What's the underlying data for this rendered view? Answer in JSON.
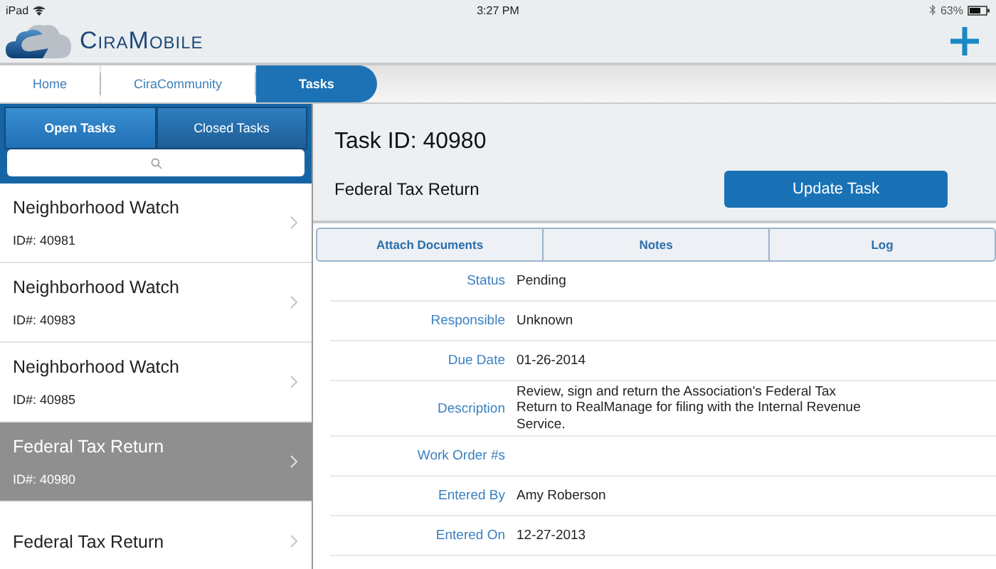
{
  "status_bar": {
    "device": "iPad",
    "time": "3:27 PM",
    "battery": "63%"
  },
  "header": {
    "logo_text": "CiraMobile"
  },
  "nav_tabs": [
    {
      "label": "Home",
      "selected": false
    },
    {
      "label": "CiraCommunity",
      "selected": false
    },
    {
      "label": "Tasks",
      "selected": true
    }
  ],
  "task_tabs": [
    {
      "label": "Open Tasks",
      "selected": true
    },
    {
      "label": "Closed Tasks",
      "selected": false
    }
  ],
  "tasks": [
    {
      "title": "Neighborhood Watch",
      "id": "ID#: 40981",
      "selected": false
    },
    {
      "title": "Neighborhood Watch",
      "id": "ID#: 40983",
      "selected": false
    },
    {
      "title": "Neighborhood Watch",
      "id": "ID#: 40985",
      "selected": false
    },
    {
      "title": "Federal Tax Return",
      "id": "ID#: 40980",
      "selected": true
    },
    {
      "title": "Federal Tax Return",
      "selected": false
    }
  ],
  "detail": {
    "task_id": "Task ID: 40980",
    "name": "Federal Tax Return",
    "update_button": "Update Task",
    "tabs": [
      "Attach Documents",
      "Notes",
      "Log"
    ],
    "fields": [
      {
        "label": "Status",
        "value": "Pending"
      },
      {
        "label": "Responsible",
        "value": "Unknown"
      },
      {
        "label": "Due Date",
        "value": "01-26-2014"
      },
      {
        "label": "Description",
        "value": "Review, sign and return the Association's Federal Tax Return to RealManage for filing with the Internal Revenue Service."
      },
      {
        "label": "Work Order #s"
      },
      {
        "label": "Entered By",
        "value": "Amy Roberson"
      },
      {
        "label": "Entered On",
        "value": "12-27-2013"
      }
    ]
  }
}
